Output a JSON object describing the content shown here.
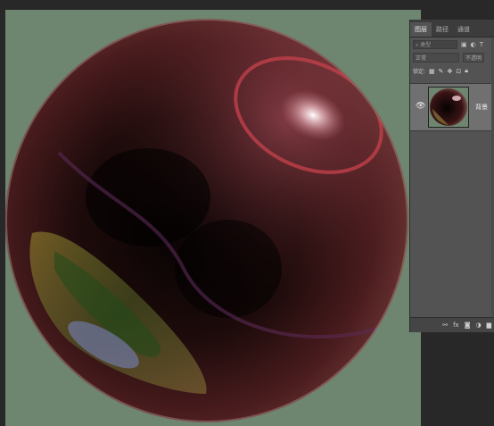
{
  "canvas": {
    "background": "#6e8570"
  },
  "panel": {
    "tabs": [
      {
        "label": "图层"
      },
      {
        "label": "路径"
      },
      {
        "label": "通道"
      }
    ],
    "filter": {
      "kind_label": "类型"
    },
    "blend_mode": "正常",
    "opacity_label": "不透明",
    "lock_label": "锁定:",
    "layers": [
      {
        "name": "背景",
        "visible_icon": "eye-icon",
        "thumbnail": "sphere-thumbnail"
      }
    ],
    "footer_icons": [
      "link-icon",
      "fx-icon",
      "mask-icon",
      "adjustment-icon",
      "group-icon"
    ]
  }
}
